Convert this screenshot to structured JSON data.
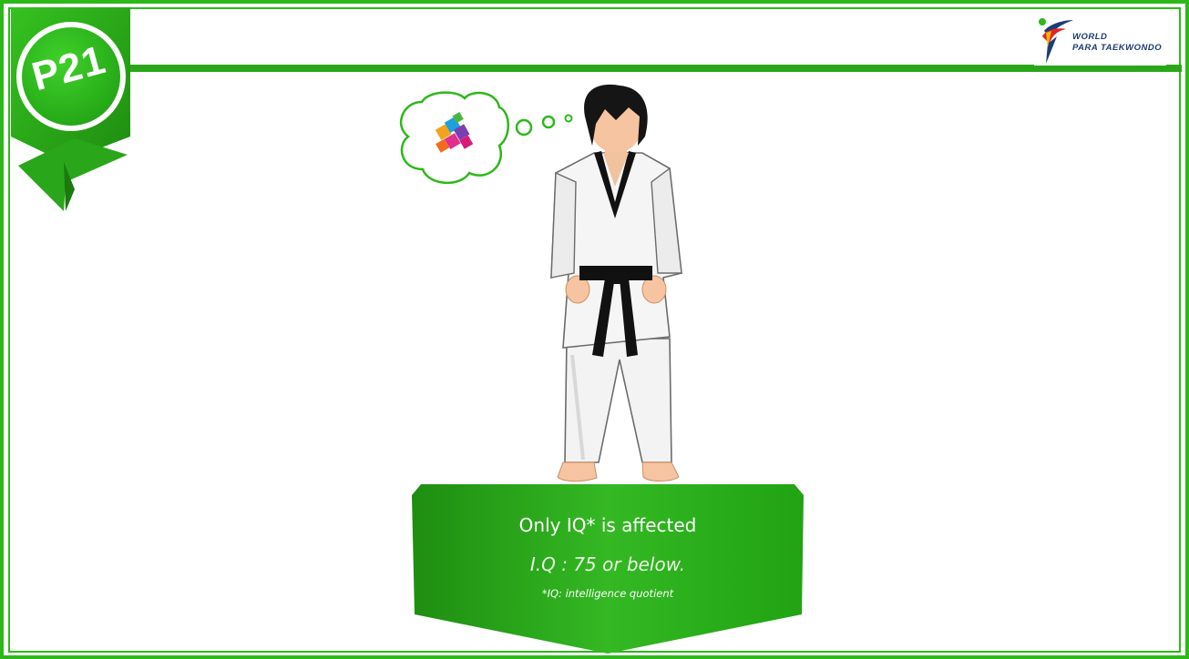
{
  "slide": {
    "badge_label": "P21",
    "logo": {
      "line1": "WORLD",
      "line2": "PARA TAEKWONDO"
    },
    "banner": {
      "title": "Only IQ* is affected",
      "criterion": "I.Q : 75 or below.",
      "footnote": "*IQ: intelligence quotient"
    },
    "colors": {
      "frame_green": "#2db81a",
      "banner_green": "#27a818",
      "belt": "#111111",
      "logo_navy": "#1d3b78",
      "logo_red": "#e02424"
    },
    "icons": {
      "thought": "puzzle-thought-bubble-icon",
      "athlete": "taekwondo-athlete-illustration"
    }
  }
}
